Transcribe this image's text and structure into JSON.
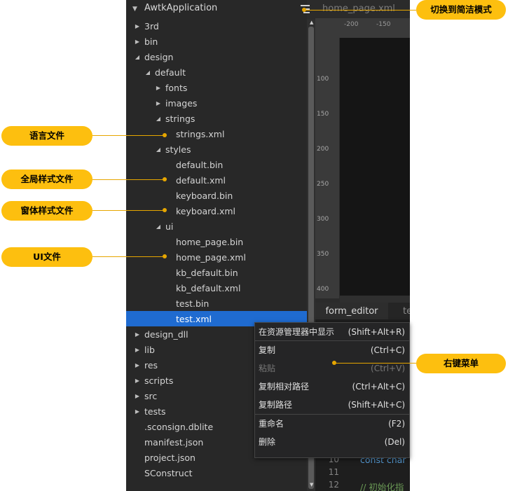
{
  "explorer": {
    "title": "AwtkApplication",
    "rows": [
      {
        "label": "3rd",
        "arrow": "right"
      },
      {
        "label": "bin",
        "arrow": "right"
      },
      {
        "label": "design",
        "arrow": "down"
      },
      {
        "label": "default",
        "arrow": "down"
      },
      {
        "label": "fonts",
        "arrow": "right"
      },
      {
        "label": "images",
        "arrow": "right"
      },
      {
        "label": "strings",
        "arrow": "down"
      },
      {
        "label": "strings.xml",
        "arrow": "none"
      },
      {
        "label": "styles",
        "arrow": "down"
      },
      {
        "label": "default.bin",
        "arrow": "none"
      },
      {
        "label": "default.xml",
        "arrow": "none"
      },
      {
        "label": "keyboard.bin",
        "arrow": "none"
      },
      {
        "label": "keyboard.xml",
        "arrow": "none"
      },
      {
        "label": "ui",
        "arrow": "down"
      },
      {
        "label": "home_page.bin",
        "arrow": "none"
      },
      {
        "label": "home_page.xml",
        "arrow": "none"
      },
      {
        "label": "kb_default.bin",
        "arrow": "none"
      },
      {
        "label": "kb_default.xml",
        "arrow": "none"
      },
      {
        "label": "test.bin",
        "arrow": "none"
      },
      {
        "label": "test.xml",
        "arrow": "none",
        "selected": true
      },
      {
        "label": "design_dll",
        "arrow": "right"
      },
      {
        "label": "lib",
        "arrow": "right"
      },
      {
        "label": "res",
        "arrow": "right"
      },
      {
        "label": "scripts",
        "arrow": "right"
      },
      {
        "label": "src",
        "arrow": "right"
      },
      {
        "label": "tests",
        "arrow": "right"
      },
      {
        "label": ".sconsign.dblite",
        "arrow": "none"
      },
      {
        "label": "manifest.json",
        "arrow": "none"
      },
      {
        "label": "project.json",
        "arrow": "none"
      },
      {
        "label": "SConstruct",
        "arrow": "none"
      }
    ]
  },
  "editor": {
    "tab_title": "home_page.xml",
    "ruler_h": [
      "-200",
      "-150"
    ],
    "ruler_v": [
      "100",
      "150",
      "200",
      "250",
      "300",
      "350",
      "400"
    ],
    "tabs": [
      "form_editor",
      "te"
    ],
    "code": [
      {
        "num": "10",
        "text": "const char"
      },
      {
        "num": "11",
        "text": ""
      },
      {
        "num": "12",
        "text": "// 初始化指"
      }
    ]
  },
  "context_menu": {
    "items": [
      {
        "label": "在资源管理器中显示",
        "shortcut": "(Shift+Alt+R)",
        "disabled": false
      },
      {
        "label": "复制",
        "shortcut": "(Ctrl+C)",
        "disabled": false
      },
      {
        "label": "粘贴",
        "shortcut": "(Ctrl+V)",
        "disabled": true
      },
      {
        "label": "复制相对路径",
        "shortcut": "(Ctrl+Alt+C)",
        "disabled": false
      },
      {
        "label": "复制路径",
        "shortcut": "(Shift+Alt+C)",
        "disabled": false
      },
      {
        "label": "重命名",
        "shortcut": "(F2)",
        "disabled": false
      },
      {
        "label": "删除",
        "shortcut": "(Del)",
        "disabled": false
      }
    ]
  },
  "callouts": {
    "toggle_mode": "切换到简洁模式",
    "language_file": "语言文件",
    "global_style": "全局样式文件",
    "window_style": "窗体样式文件",
    "ui_file": "UI文件",
    "context_menu": "右键菜单"
  },
  "colors": {
    "callout": "#fdbf0f",
    "selection": "#1f6bd0",
    "tree_bg": "#282828"
  }
}
